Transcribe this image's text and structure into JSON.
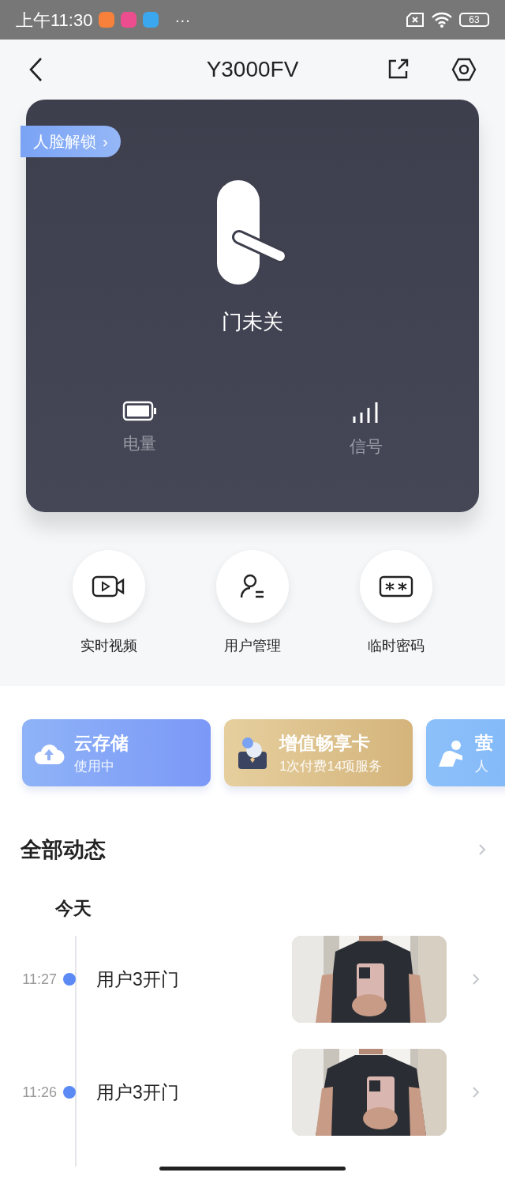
{
  "status_bar": {
    "time": "上午11:30",
    "more": "···",
    "battery": "63"
  },
  "header": {
    "title": "Y3000FV"
  },
  "lock_card": {
    "badge": "人脸解锁",
    "badge_arrow": "›",
    "status": "门未关",
    "indicators": [
      {
        "kind": "battery",
        "label": "电量"
      },
      {
        "kind": "signal",
        "label": "信号"
      }
    ]
  },
  "actions": [
    {
      "kind": "video",
      "label": "实时视频"
    },
    {
      "kind": "users",
      "label": "用户管理"
    },
    {
      "kind": "password",
      "label": "临时密码"
    }
  ],
  "services": [
    {
      "kind": "cloud",
      "title": "云存储",
      "subtitle": "使用中"
    },
    {
      "kind": "vip",
      "title": "增值畅享卡",
      "subtitle": "1次付费14项服务"
    },
    {
      "kind": "care",
      "title": "萤",
      "subtitle": "人"
    }
  ],
  "activity": {
    "title": "全部动态",
    "day": "今天",
    "events": [
      {
        "time": "11:27",
        "text": "用户3开门"
      },
      {
        "time": "11:26",
        "text": "用户3开门"
      }
    ]
  }
}
